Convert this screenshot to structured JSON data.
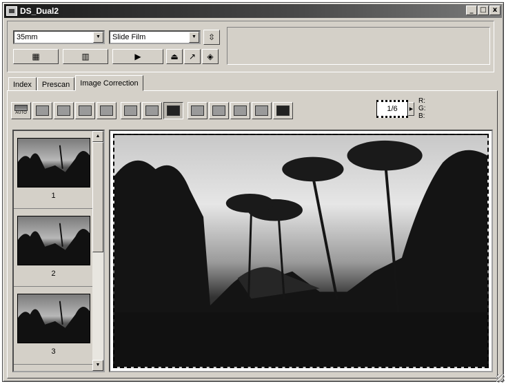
{
  "window": {
    "title": "DS_Dual2"
  },
  "title_buttons": {
    "minimize": "_",
    "maximize": "□",
    "close": "x"
  },
  "top_panel": {
    "film_format": {
      "value": "35mm"
    },
    "film_type": {
      "value": "Slide Film"
    },
    "buttons": [
      {
        "icon": "film-strip-icon"
      },
      {
        "icon": "film-frames-icon"
      },
      {
        "icon": "scan-icon"
      },
      {
        "icon": "eject-icon"
      },
      {
        "icon": "export-icon"
      },
      {
        "icon": "settings-icon"
      }
    ]
  },
  "tabs": [
    {
      "label": "Index",
      "active": false
    },
    {
      "label": "Prescan",
      "active": false
    },
    {
      "label": "Image Correction",
      "active": true
    }
  ],
  "toolbar": {
    "auto_label": "AUTO",
    "tools": [
      "auto-correct-icon",
      "curves-icon",
      "brightness-icon",
      "contrast-icon",
      "color-balance-icon",
      "rotate-icon",
      "flip-icon",
      "undo-icon",
      "snapshot-icon",
      "compare-icon",
      "dropdown-icon",
      "before-icon",
      "after-icon"
    ]
  },
  "frame_counter": {
    "value": "1/6"
  },
  "rgb_readout": {
    "r_label": "R:",
    "g_label": "G:",
    "b_label": "B:"
  },
  "thumbnails": [
    {
      "number": "1"
    },
    {
      "number": "2"
    },
    {
      "number": "3"
    }
  ],
  "colors": {
    "window_bg": "#d4d0c8",
    "titlebar": "#1a1a1a",
    "border_dark": "#404040"
  }
}
